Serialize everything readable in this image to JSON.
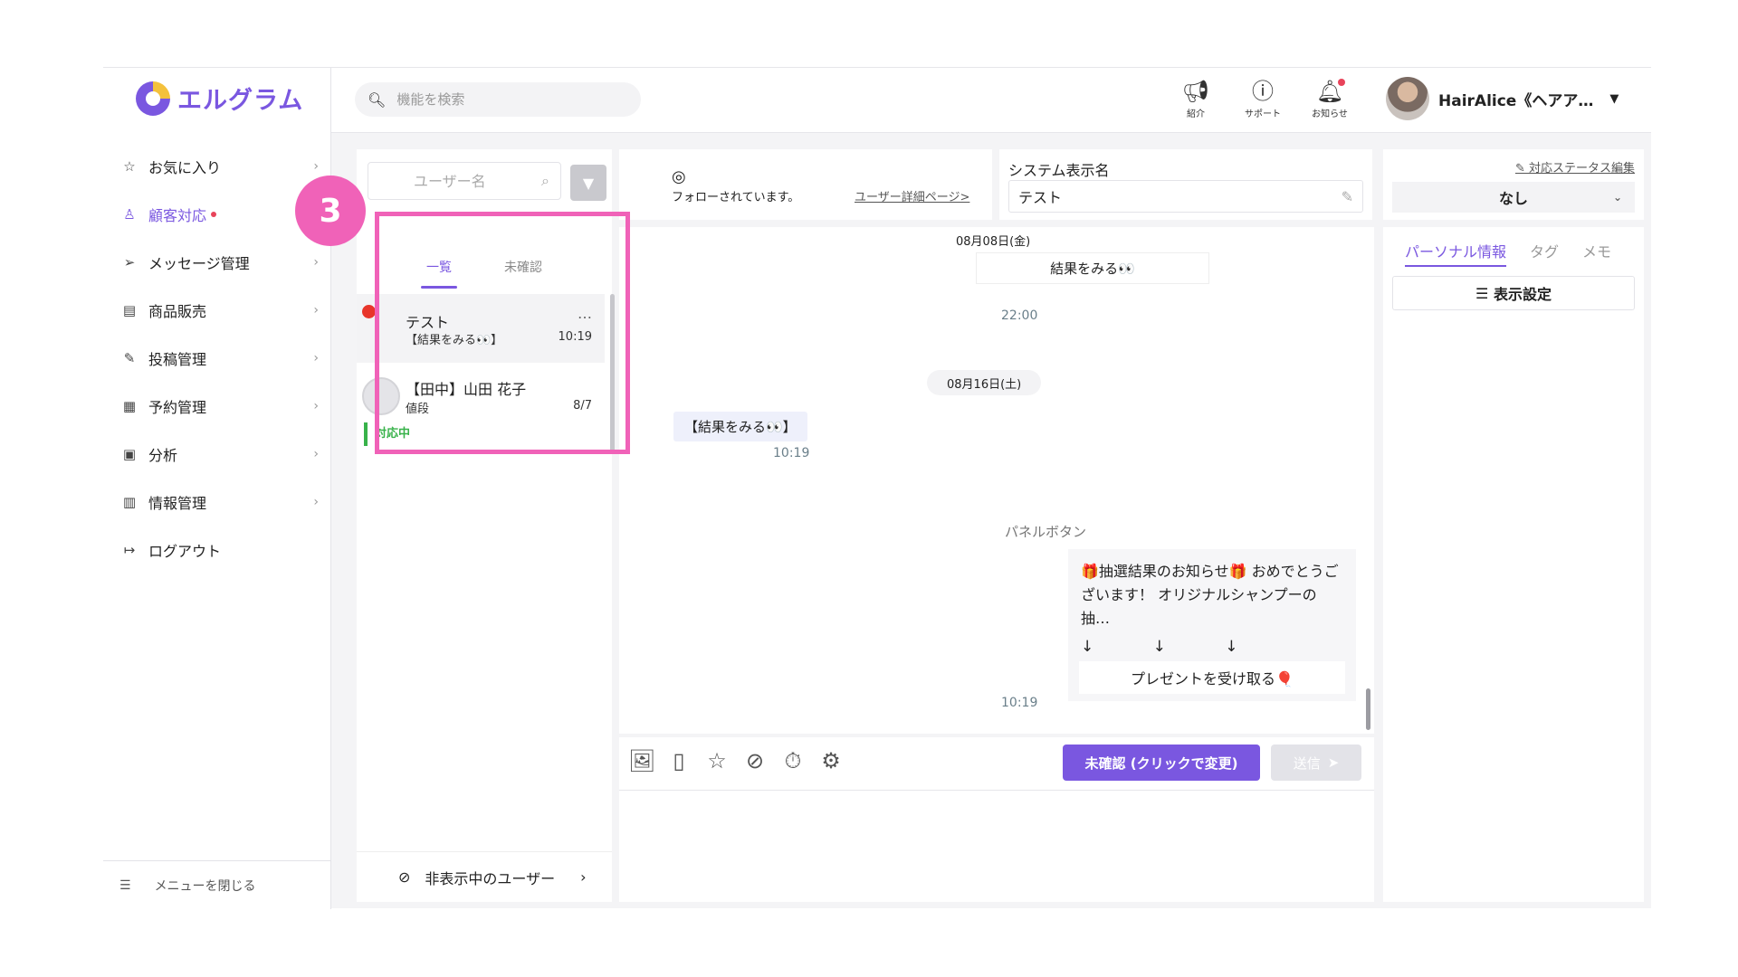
{
  "brand": {
    "name": "エルグラム"
  },
  "sidebar": {
    "items": [
      {
        "label": "お気に入り",
        "icon": "star-icon"
      },
      {
        "label": "顧客対応",
        "icon": "user-icon"
      },
      {
        "label": "メッセージ管理",
        "icon": "send-icon"
      },
      {
        "label": "商品販売",
        "icon": "shop-icon"
      },
      {
        "label": "投稿管理",
        "icon": "edit-icon"
      },
      {
        "label": "予約管理",
        "icon": "calendar-icon"
      },
      {
        "label": "分析",
        "icon": "analytics-icon"
      },
      {
        "label": "情報管理",
        "icon": "bar-chart-icon"
      },
      {
        "label": "ログアウト",
        "icon": "logout-icon"
      }
    ],
    "close_label": "メニューを閉じる"
  },
  "topbar": {
    "search_placeholder": "機能を検索",
    "icons": [
      {
        "label": "紹介",
        "icon": "megaphone-icon"
      },
      {
        "label": "サポート",
        "icon": "help-icon"
      },
      {
        "label": "お知らせ",
        "icon": "bell-icon"
      }
    ],
    "user_name": "HairAlice《ヘアア…"
  },
  "user_list": {
    "search_placeholder": "ユーザー名",
    "tabs": [
      "一覧",
      "未確認"
    ],
    "conversations": [
      {
        "name": "テスト",
        "preview": "【結果をみる👀】",
        "time": "10:19",
        "more": "…"
      },
      {
        "name": "【田中】山田 花子",
        "preview": "値段",
        "time": "8/7",
        "status": "対応中"
      }
    ],
    "hidden_users_label": "非表示中のユーザー"
  },
  "annotation": {
    "step": "3"
  },
  "chat_header": {
    "follow_text": "フォローされています。",
    "user_detail_link": "ユーザー詳細ページ>",
    "system_name_label": "システム表示名",
    "system_name_value": "テスト"
  },
  "chat": {
    "date1": "08月08日(金)",
    "msg1": "結果をみる👀",
    "time1": "22:00",
    "date2": "08月16日(土)",
    "msg2": "【結果をみる👀】",
    "time2": "10:19",
    "panel_label": "パネルボタン",
    "panel_text": "🎁抽選結果のお知らせ🎁 おめでとうございます！ オリジナルシャンプーの 抽…",
    "panel_arrows": "↓ ↓ ↓",
    "panel_button": "プレゼントを受け取る🎈",
    "time3": "10:19"
  },
  "composer": {
    "tools": [
      "image-icon",
      "document-icon",
      "star-icon",
      "eye-off-icon",
      "timer-icon",
      "gear-icon"
    ],
    "status_button": "未確認 (クリックで変更)",
    "send_button": "送信"
  },
  "right_panel": {
    "status_edit_link": "対応ステータス編集",
    "status_value": "なし",
    "tabs": [
      "パーソナル情報",
      "タグ",
      "メモ"
    ],
    "display_setting": "表示設定"
  },
  "colors": {
    "accent": "#7a57e0",
    "highlight": "#f062b8",
    "status_green": "#38b24a",
    "alert_red": "#e8435a"
  }
}
